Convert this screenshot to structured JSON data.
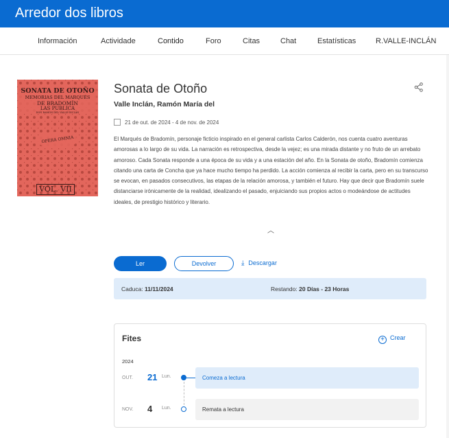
{
  "app": {
    "title": "Arredor dos libros"
  },
  "nav": {
    "tabs": [
      {
        "label": "Información"
      },
      {
        "label": "Actividade"
      },
      {
        "label": "Contido"
      },
      {
        "label": "Foro"
      },
      {
        "label": "Citas"
      },
      {
        "label": "Chat"
      },
      {
        "label": "Estatísticas"
      },
      {
        "label": "R.VALLE-INCLÁN"
      }
    ],
    "active": "Contido"
  },
  "book": {
    "cover": {
      "line1": "SONATA DE OTOÑO",
      "line2": "MEMORIAS DEL MARQUÉS",
      "line3": "DE BRADOMÍN",
      "line4": "LAS PUBLICA",
      "line5": "DON RAMÓN DEL VALLE-INCLÁN",
      "opera": "OPERA OMNIA",
      "vol": "VOL. VII"
    },
    "title": "Sonata de Otoño",
    "author": "Valle Inclán, Ramón María del",
    "dates": "21 de out. de 2024 - 4 de nov. de 2024",
    "description": "El Marqués de Bradomín, personaje ficticio inspirado en el general carlista Carlos Calderón, nos cuenta cuatro aventuras amorosas a lo largo de su vida. La narración es retrospectiva, desde la vejez; es una mirada distante y no fruto de un arrebato amoroso. Cada Sonata responde a una época de su vida y a una estación del año. En la Sonata de otoño, Bradomín comienza citando una carta de Concha que ya hace mucho tiempo ha perdido. La acción comienza al recibir la carta, pero en su transcurso se evocan, en pasados consecutivos, las etapas de la relación amorosa, y también el futuro. Hay que decir que Bradomín suele distanciarse irónicamente de la realidad, idealizando el pasado, enjuiciando sus propios actos o modeándose de actitudes ideales, de prestigio histórico y literario.",
    "collapse_icon": "chevron-up-icon",
    "share_icon": "share-icon"
  },
  "actions": {
    "read_label": "Ler",
    "return_label": "Devolver",
    "download_label": "Descargar"
  },
  "expiry": {
    "expires_label": "Caduca:",
    "expires_value": "11/11/2024",
    "remaining_label": "Restando:",
    "remaining_value": "20 Días - 23 Horas"
  },
  "milestones": {
    "title": "Fites",
    "create_label": "Crear",
    "year": "2024",
    "items": [
      {
        "month": "OUT.",
        "day": "21",
        "weekday": "Lun.",
        "label": "Comeza a lectura"
      },
      {
        "month": "NOV.",
        "day": "4",
        "weekday": "Lun.",
        "label": "Remata a lectura"
      }
    ]
  },
  "colors": {
    "primary": "#0a6bd1",
    "light_blue": "#dfecfa",
    "cover_red": "#e3665c"
  }
}
